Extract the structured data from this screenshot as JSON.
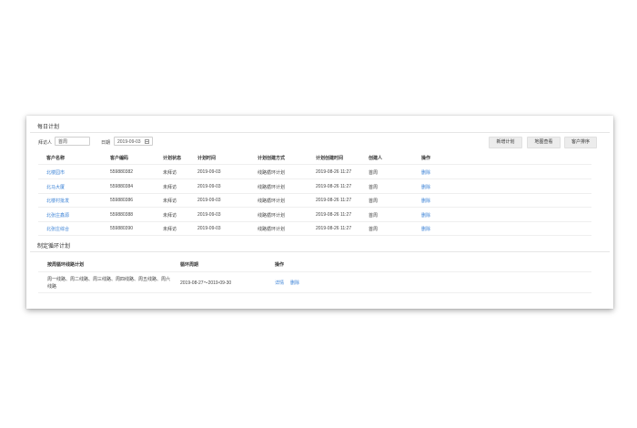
{
  "daily_plan": {
    "title": "每日计划",
    "filters": {
      "visitor_label": "拜访人",
      "visitor_value": "首周",
      "date_label": "日期",
      "date_value": "2019-09-03",
      "calendar_icon": "calendar-icon"
    },
    "buttons": {
      "add_plan": "新增计划",
      "map_view": "地图查看",
      "customer_sort": "客户排序"
    },
    "columns": [
      "客户名称",
      "客户编码",
      "计划状态",
      "计划时间",
      "计划创建方式",
      "计划创建时间",
      "创建人",
      "操作"
    ],
    "rows": [
      {
        "name": "北楼园市",
        "code": "559880382",
        "status": "未拜访",
        "time": "2019-09-03",
        "method": "线路循环计划",
        "created": "2019-08-26 11:27",
        "creator": "首周",
        "action": "删除"
      },
      {
        "name": "北马大厦",
        "code": "559880384",
        "status": "未拜访",
        "time": "2019-09-03",
        "method": "线路循环计划",
        "created": "2019-08-26 11:27",
        "creator": "首周",
        "action": "删除"
      },
      {
        "name": "北楼村批发",
        "code": "559880386",
        "status": "未拜访",
        "time": "2019-09-03",
        "method": "线路循环计划",
        "created": "2019-08-26 11:27",
        "creator": "首周",
        "action": "删除"
      },
      {
        "name": "北张庄鑫源",
        "code": "559880388",
        "status": "未拜访",
        "time": "2019-09-03",
        "method": "线路循环计划",
        "created": "2019-08-26 11:27",
        "creator": "首周",
        "action": "删除"
      },
      {
        "name": "北张庄综合",
        "code": "559880390",
        "status": "未拜访",
        "time": "2019-09-03",
        "method": "线路循环计划",
        "created": "2019-08-26 11:27",
        "creator": "首周",
        "action": "删除"
      }
    ]
  },
  "loop_plan": {
    "title": "制定循环计划",
    "columns": [
      "按周循环线路计划",
      "循环周期",
      "操作"
    ],
    "rows": [
      {
        "routes_line1": "周一线路、周二线路、周三线路、周四线路、周五线路、周六",
        "routes_line2": "线路",
        "period": "2019-08-27～2019-09-30",
        "detail": "详情",
        "delete": "删除"
      }
    ]
  },
  "colors": {
    "link": "#3b82d6",
    "button_bg": "#ececec",
    "text": "#333333"
  }
}
